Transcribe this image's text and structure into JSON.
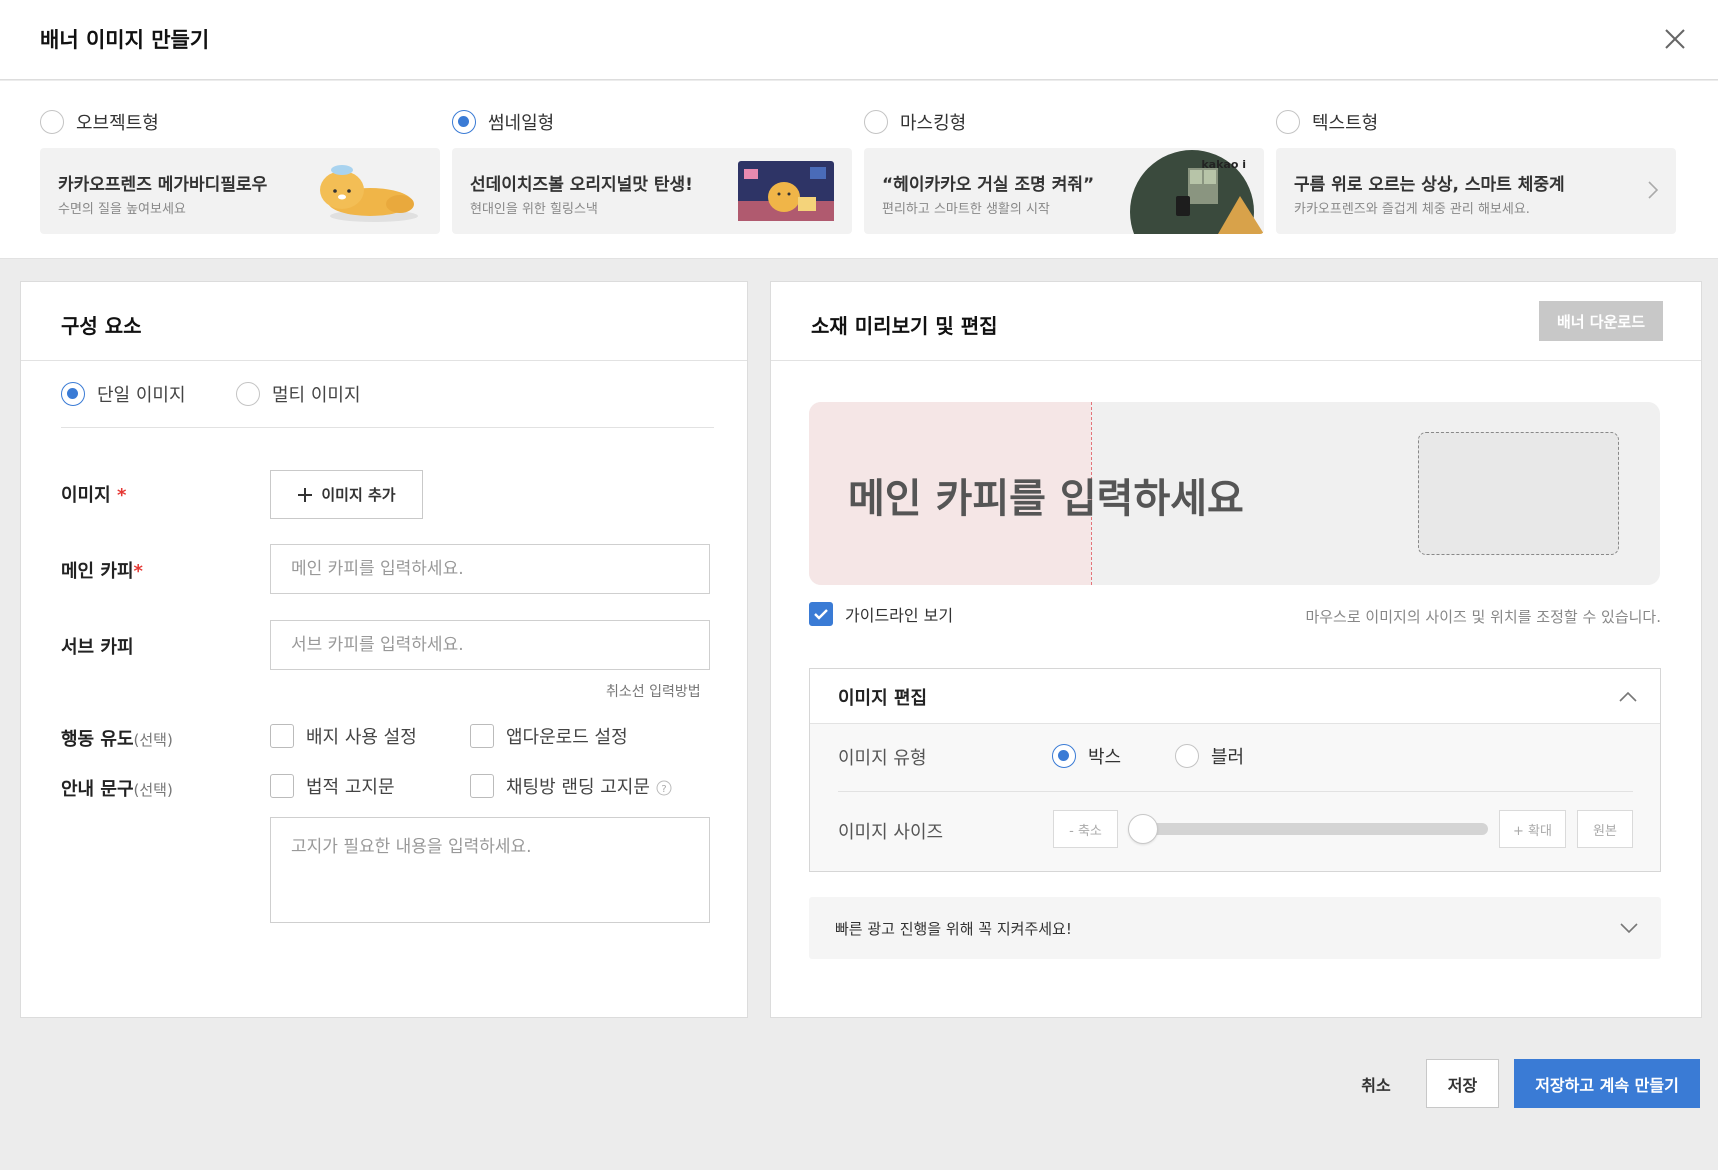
{
  "header": {
    "title": "배너 이미지 만들기"
  },
  "banner_types": [
    {
      "label": "오브젝트형",
      "selected": false,
      "card_title": "카카오프렌즈 메가바디필로우",
      "card_sub": "수면의 질을 높여보세요"
    },
    {
      "label": "썸네일형",
      "selected": true,
      "card_title": "선데이치즈볼 오리지널맛 탄생!",
      "card_sub": "현대인을 위한 힐링스낵"
    },
    {
      "label": "마스킹형",
      "selected": false,
      "card_title": "“헤이카카오 거실 조명 켜줘”",
      "card_sub": "편리하고 스마트한 생활의 시작",
      "logo": "kakao i"
    },
    {
      "label": "텍스트형",
      "selected": false,
      "card_title": "구름 위로 오르는 상상, 스마트 체중계",
      "card_sub": "카카오프렌즈와 즐겁게 체중 관리 해보세요."
    }
  ],
  "components": {
    "title": "구성 요소",
    "image_mode": {
      "single": "단일 이미지",
      "multi": "멀티 이미지",
      "selected": "single"
    },
    "image_label": "이미지",
    "add_image": "이미지 추가",
    "main_copy_label": "메인 카피",
    "main_copy_placeholder": "메인 카피를 입력하세요.",
    "main_copy_value": "",
    "sub_copy_label": "서브 카피",
    "sub_copy_placeholder": "서브 카피를 입력하세요.",
    "sub_copy_value": "",
    "strike_help": "취소선 입력방법",
    "cta_label": "행동 유도",
    "optional": "(선택)",
    "badge_setting": "배지 사용 설정",
    "app_download_setting": "앱다운로드 설정",
    "notice_label": "안내 문구",
    "legal_notice": "법적 고지문",
    "chat_landing_notice": "채팅방 랜딩 고지문",
    "notice_placeholder": "고지가 필요한 내용을 입력하세요.",
    "notice_value": ""
  },
  "preview": {
    "title": "소재 미리보기 및 편집",
    "download": "배너 다운로드",
    "placeholder_copy": "메인 카피를 입력하세요",
    "guideline_label": "가이드라인 보기",
    "guideline_checked": true,
    "hint": "마우스로 이미지의 사이즈 및 위치를 조정할 수 있습니다."
  },
  "image_edit": {
    "title": "이미지 편집",
    "type_label": "이미지 유형",
    "type_box": "박스",
    "type_blur": "블러",
    "type_selected": "box",
    "size_label": "이미지 사이즈",
    "zoom_out": "- 축소",
    "zoom_in": "+ 확대",
    "original": "원본",
    "size_fraction": 0.0
  },
  "notice_bar": {
    "text": "빠른 광고 진행을 위해 꼭 지켜주세요!"
  },
  "footer": {
    "cancel": "취소",
    "save": "저장",
    "save_continue": "저장하고 계속 만들기"
  },
  "colors": {
    "accent": "#3a7bd5",
    "required": "#e53935",
    "disabled_button": "#c8c8c8"
  }
}
